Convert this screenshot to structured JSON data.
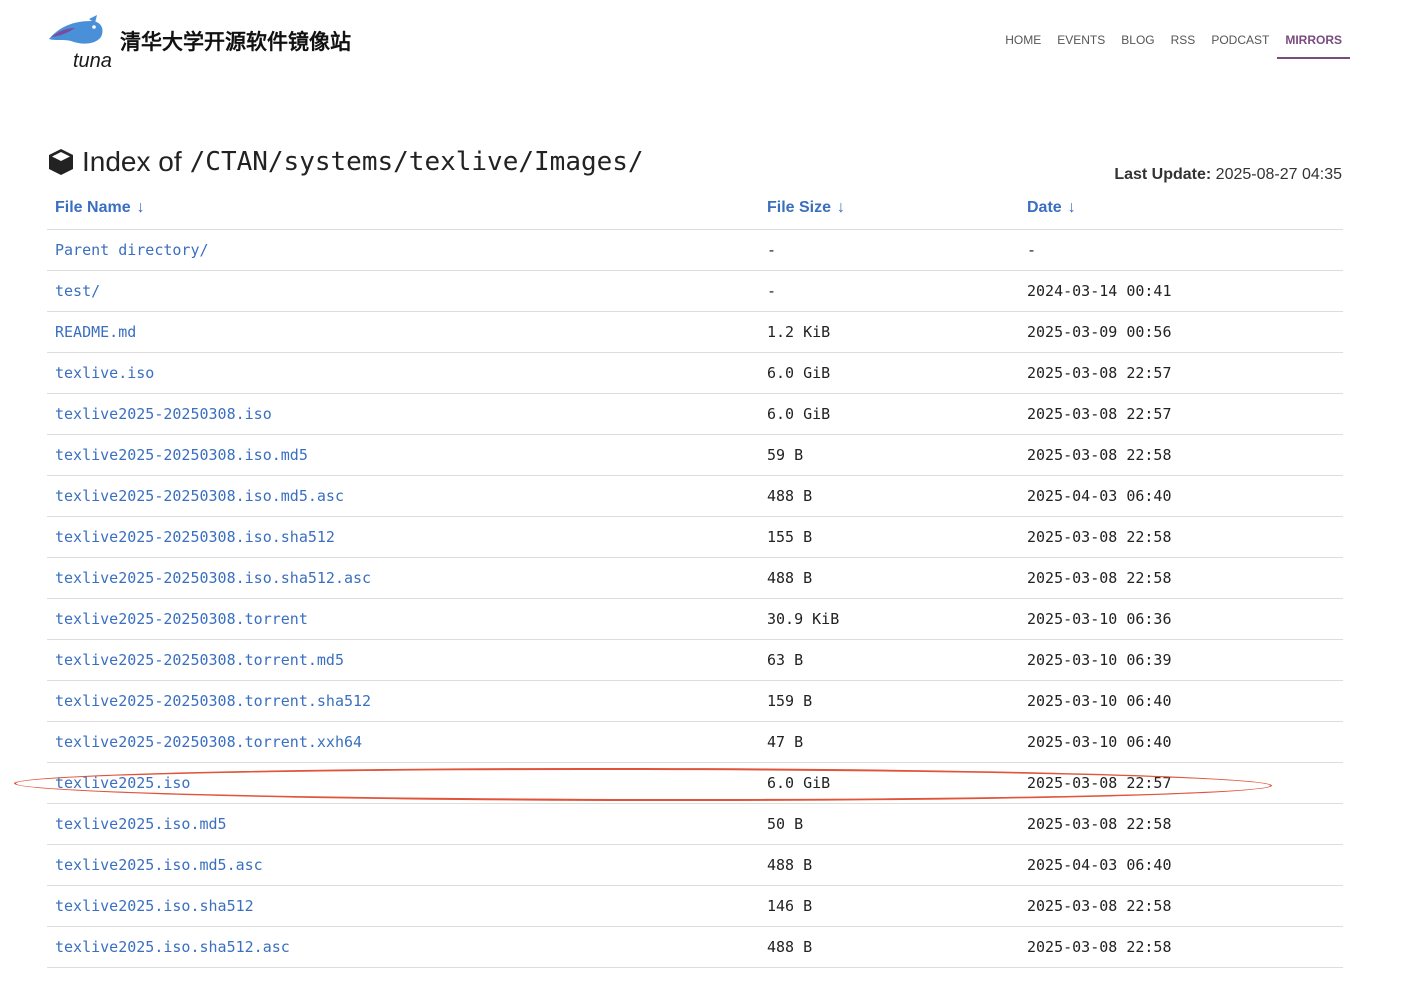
{
  "site": {
    "title": "清华大学开源软件镜像站",
    "logo_text": "tuna"
  },
  "nav": [
    {
      "label": "HOME",
      "active": false
    },
    {
      "label": "EVENTS",
      "active": false
    },
    {
      "label": "BLOG",
      "active": false
    },
    {
      "label": "RSS",
      "active": false
    },
    {
      "label": "PODCAST",
      "active": false
    },
    {
      "label": "MIRRORS",
      "active": true
    }
  ],
  "heading": {
    "label": "Index of",
    "path": "/CTAN/systems/texlive/Images/"
  },
  "last_update": {
    "label": "Last Update:",
    "value": "2025-08-27 04:35"
  },
  "columns": {
    "name": "File Name",
    "size": "File Size",
    "date": "Date",
    "sort_arrow": "↓"
  },
  "rows": [
    {
      "name": "Parent directory/",
      "size": "-",
      "date": "-"
    },
    {
      "name": "test/",
      "size": "-",
      "date": "2024-03-14 00:41"
    },
    {
      "name": "README.md",
      "size": "1.2 KiB",
      "date": "2025-03-09 00:56"
    },
    {
      "name": "texlive.iso",
      "size": "6.0 GiB",
      "date": "2025-03-08 22:57"
    },
    {
      "name": "texlive2025-20250308.iso",
      "size": "6.0 GiB",
      "date": "2025-03-08 22:57"
    },
    {
      "name": "texlive2025-20250308.iso.md5",
      "size": "59 B",
      "date": "2025-03-08 22:58"
    },
    {
      "name": "texlive2025-20250308.iso.md5.asc",
      "size": "488 B",
      "date": "2025-04-03 06:40"
    },
    {
      "name": "texlive2025-20250308.iso.sha512",
      "size": "155 B",
      "date": "2025-03-08 22:58"
    },
    {
      "name": "texlive2025-20250308.iso.sha512.asc",
      "size": "488 B",
      "date": "2025-03-08 22:58"
    },
    {
      "name": "texlive2025-20250308.torrent",
      "size": "30.9 KiB",
      "date": "2025-03-10 06:36"
    },
    {
      "name": "texlive2025-20250308.torrent.md5",
      "size": "63 B",
      "date": "2025-03-10 06:39"
    },
    {
      "name": "texlive2025-20250308.torrent.sha512",
      "size": "159 B",
      "date": "2025-03-10 06:40"
    },
    {
      "name": "texlive2025-20250308.torrent.xxh64",
      "size": "47 B",
      "date": "2025-03-10 06:40"
    },
    {
      "name": "texlive2025.iso",
      "size": "6.0 GiB",
      "date": "2025-03-08 22:57",
      "highlighted": true
    },
    {
      "name": "texlive2025.iso.md5",
      "size": "50 B",
      "date": "2025-03-08 22:58"
    },
    {
      "name": "texlive2025.iso.md5.asc",
      "size": "488 B",
      "date": "2025-04-03 06:40"
    },
    {
      "name": "texlive2025.iso.sha512",
      "size": "146 B",
      "date": "2025-03-08 22:58"
    },
    {
      "name": "texlive2025.iso.sha512.asc",
      "size": "488 B",
      "date": "2025-03-08 22:58"
    }
  ],
  "colors": {
    "link": "#3a6fc0",
    "nav_active": "#7a4b7f",
    "annotation": "#e0543a"
  }
}
